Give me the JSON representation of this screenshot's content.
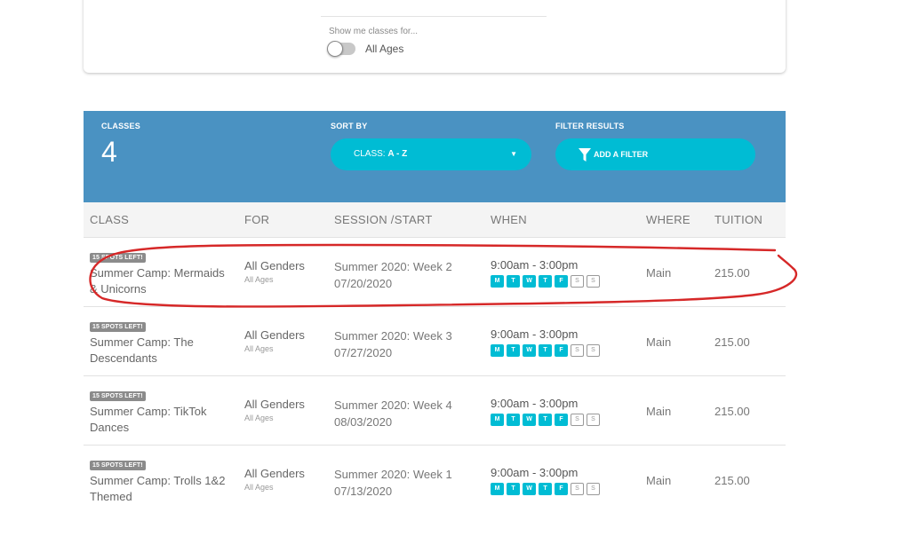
{
  "filters": {
    "show_label": "Show me classes for...",
    "ages_label": "All Ages"
  },
  "header": {
    "classes_label": "CLASSES",
    "count": "4",
    "sort_label": "SORT BY",
    "sort_prefix": "CLASS: ",
    "sort_value": "A - Z",
    "caret": "▼",
    "filter_label": "FILTER RESULTS",
    "add_filter": "ADD A FILTER"
  },
  "columns": {
    "class": "CLASS",
    "for": "FOR",
    "session": "SESSION /START",
    "when": "WHEN",
    "where": "WHERE",
    "tuition": "TUITION"
  },
  "day_letters": [
    "M",
    "T",
    "W",
    "T",
    "F",
    "S",
    "S"
  ],
  "rows": [
    {
      "badge": "15 SPOTS LEFT!",
      "name": "Summer Camp: Mermaids & Unicorns",
      "for_main": "All Genders",
      "for_sub": "All Ages",
      "session": "Summer 2020: Week 2",
      "start": "07/20/2020",
      "time": "9:00am - 3:00pm",
      "where": "Main",
      "tuition": "215.00"
    },
    {
      "badge": "15 SPOTS LEFT!",
      "name": "Summer Camp: The Descendants",
      "for_main": "All Genders",
      "for_sub": "All Ages",
      "session": "Summer 2020: Week 3",
      "start": "07/27/2020",
      "time": "9:00am - 3:00pm",
      "where": "Main",
      "tuition": "215.00"
    },
    {
      "badge": "15 SPOTS LEFT!",
      "name": "Summer Camp: TikTok Dances",
      "for_main": "All Genders",
      "for_sub": "All Ages",
      "session": "Summer 2020: Week 4",
      "start": "08/03/2020",
      "time": "9:00am - 3:00pm",
      "where": "Main",
      "tuition": "215.00"
    },
    {
      "badge": "15 SPOTS LEFT!",
      "name": "Summer Camp: Trolls 1&2 Themed",
      "for_main": "All Genders",
      "for_sub": "All Ages",
      "session": "Summer 2020: Week 1",
      "start": "07/13/2020",
      "time": "9:00am - 3:00pm",
      "where": "Main",
      "tuition": "215.00"
    }
  ],
  "colors": {
    "header_blue": "#4a92c2",
    "pill_cyan": "#00bcd4",
    "badge_gray": "#8b8b8b",
    "annotation_red": "#d62828"
  }
}
